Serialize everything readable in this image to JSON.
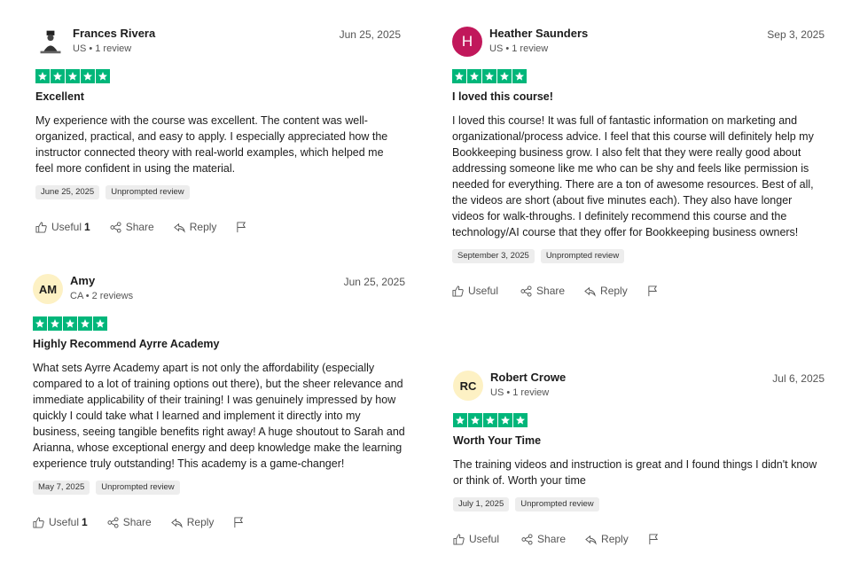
{
  "reviews": [
    {
      "name": "Frances Rivera",
      "meta": "US • 1 review",
      "date": "Jun 25, 2025",
      "avatar_initials": "",
      "avatar_icon": "portrait-icon",
      "title": "Excellent",
      "body": "My experience with the course was excellent. The content was well-organized, practical, and easy to apply. I especially appreciated how the instructor connected theory with real-world examples, which helped me feel more confident in using the material.",
      "experience_date": "June 25, 2025",
      "tag": "Unprompted review",
      "useful_label": "Useful",
      "useful_count": "1",
      "share_label": "Share",
      "reply_label": "Reply"
    },
    {
      "name": "Heather Saunders",
      "meta": "US • 1 review",
      "date": "Sep 3, 2025",
      "avatar_initials": "H",
      "title": "I loved this course!",
      "body": "I loved this course! It was full of fantastic information on marketing and organizational/process advice. I feel that this course will definitely help my Bookkeeping business grow. I also felt that they were really good about addressing someone like me who can be shy and feels like permission is needed for everything. There are a ton of awesome resources. Best of all, the videos are short (about five minutes each). They also have longer videos for walk-throughs. I definitely recommend this course and the technology/AI course that they offer for Bookkeeping business owners!",
      "experience_date": "September 3, 2025",
      "tag": "Unprompted review",
      "useful_label": "Useful",
      "useful_count": "",
      "share_label": "Share",
      "reply_label": "Reply"
    },
    {
      "name": "Amy",
      "meta": "CA • 2 reviews",
      "date": "Jun 25, 2025",
      "avatar_initials": "AM",
      "title": "Highly Recommend Ayrre Academy",
      "body": "What sets Ayrre Academy apart is not only the affordability (especially compared to a lot of training options out there), but the sheer relevance and immediate applicability of their training! I was genuinely impressed by how quickly I could take what I learned and implement it directly into my business, seeing tangible benefits right away! A huge shoutout to Sarah and Arianna, whose exceptional energy and deep knowledge make the learning experience truly outstanding! This academy is a game-changer!",
      "experience_date": "May 7, 2025",
      "tag": "Unprompted review",
      "useful_label": "Useful",
      "useful_count": "1",
      "share_label": "Share",
      "reply_label": "Reply"
    },
    {
      "name": "Robert Crowe",
      "meta": "US • 1 review",
      "date": "Jul 6, 2025",
      "avatar_initials": "RC",
      "title": "Worth Your Time",
      "body": "The training videos and instruction is great and I found things I didn't know or think of. Worth your time",
      "experience_date": "July 1, 2025",
      "tag": "Unprompted review",
      "useful_label": "Useful",
      "useful_count": "",
      "share_label": "Share",
      "reply_label": "Reply"
    }
  ],
  "colors": {
    "star_green": "#00b67a",
    "avatar_magenta": "#c1185b",
    "avatar_yellow": "#fdf1c4"
  },
  "rating": 5
}
